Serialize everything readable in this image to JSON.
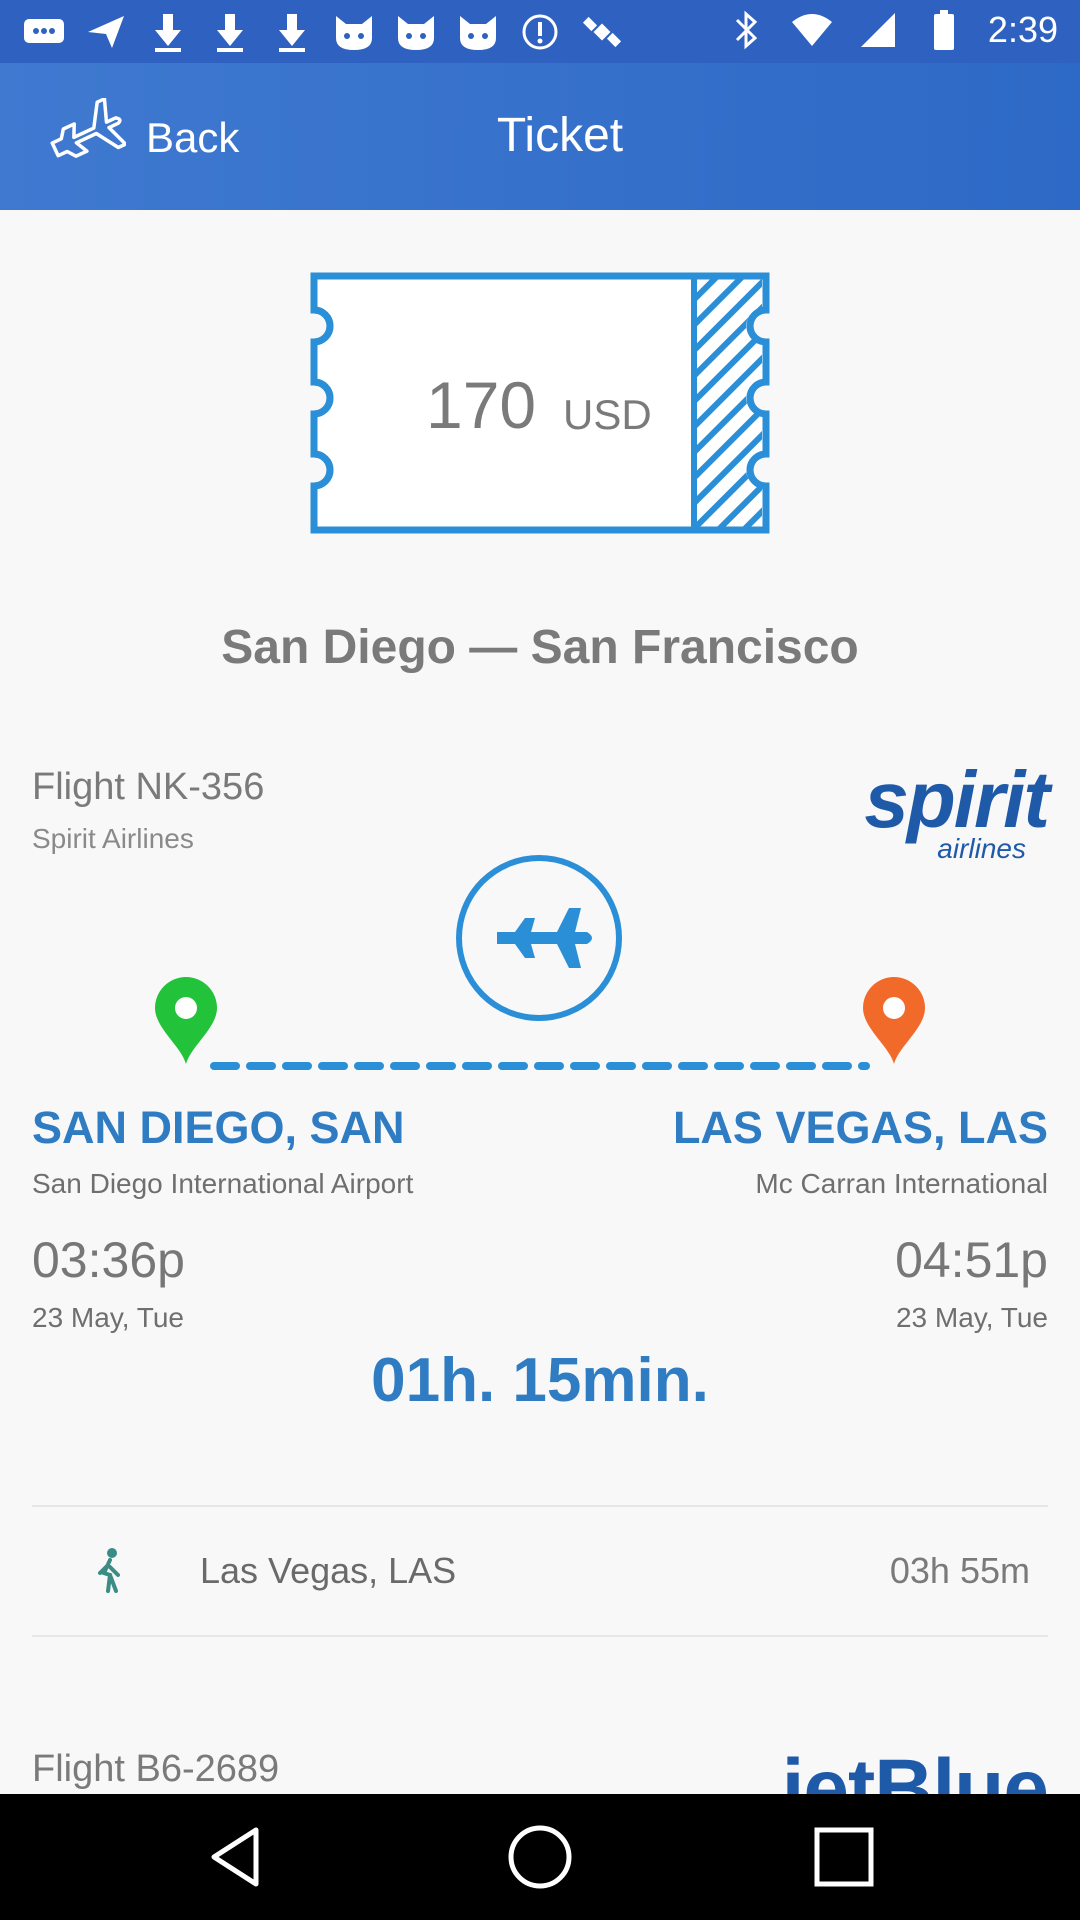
{
  "status_bar": {
    "time": "2:39",
    "icons": [
      "messages-icon",
      "send-icon",
      "download-icon",
      "download-icon",
      "download-icon",
      "cat-icon",
      "cat-icon",
      "cat-icon",
      "info-icon",
      "satellite-icon",
      "bluetooth-icon",
      "wifi-icon",
      "signal-icon",
      "battery-icon"
    ]
  },
  "app_bar": {
    "back_label": "Back",
    "title": "Ticket"
  },
  "ticket": {
    "amount": "170",
    "currency": "USD"
  },
  "route_title": "San Diego — San Francisco",
  "flight1": {
    "number": "Flight NK-356",
    "airline": "Spirit Airlines",
    "logo_main": "spirit",
    "logo_sub": "airlines",
    "origin_city": "SAN DIEGO, SAN",
    "origin_airport": "San Diego International Airport",
    "dest_city": "LAS VEGAS, LAS",
    "dest_airport": "Mc Carran International",
    "depart_time": "03:36p",
    "arrive_time": "04:51p",
    "depart_date": "23 May, Tue",
    "arrive_date": "23 May, Tue",
    "duration": "01h. 15min."
  },
  "layover": {
    "city": "Las Vegas, LAS",
    "time": "03h 55m"
  },
  "flight2": {
    "number": "Flight B6-2689",
    "logo": "jetBlue"
  },
  "colors": {
    "primary": "#2f7cc2",
    "appbar": "#3a72cc",
    "origin_pin": "#22c33a",
    "dest_pin": "#f26a2a"
  }
}
